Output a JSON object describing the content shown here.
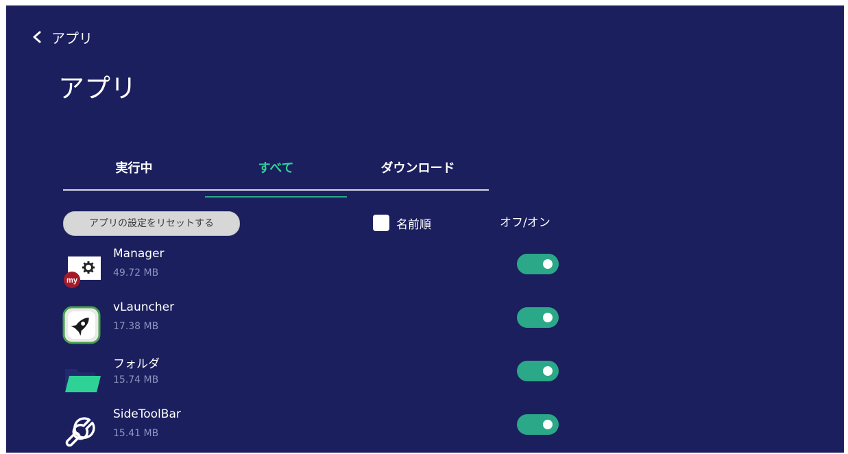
{
  "header": {
    "back_label": "アプリ",
    "title": "アプリ"
  },
  "tabs": [
    {
      "label": "実行中",
      "active": false
    },
    {
      "label": "すべて",
      "active": true
    },
    {
      "label": "ダウンロード",
      "active": false
    }
  ],
  "toolbar": {
    "reset_label": "アプリの設定をリセットする",
    "sort_label": "名前順",
    "sort_checked": false,
    "onoff_header": "オフ/オン"
  },
  "apps": [
    {
      "name": "Manager",
      "size": "49.72 MB",
      "icon": "mymanager-icon",
      "enabled": true
    },
    {
      "name": "vLauncher",
      "size": "17.38 MB",
      "icon": "rocket-icon",
      "enabled": true
    },
    {
      "name": "フォルダ",
      "size": "15.74 MB",
      "icon": "folder-icon",
      "enabled": true
    },
    {
      "name": "SideToolBar",
      "size": "15.41 MB",
      "icon": "wrench-icon",
      "enabled": true
    }
  ],
  "colors": {
    "background": "#1b1f5e",
    "accent": "#2aa888",
    "active_tab_text": "#2fd296"
  }
}
